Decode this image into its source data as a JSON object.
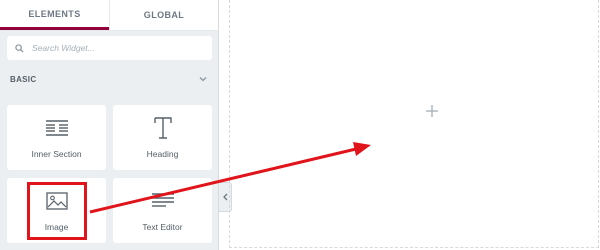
{
  "panel": {
    "tabs": [
      {
        "label": "ELEMENTS",
        "active": true
      },
      {
        "label": "GLOBAL",
        "active": false
      }
    ],
    "search": {
      "placeholder": "Search Widget...",
      "icon": "search-icon"
    },
    "section": {
      "title": "BASIC",
      "icon": "chevron-down-icon"
    },
    "widgets": [
      {
        "label": "Inner Section",
        "icon": "inner-section-icon"
      },
      {
        "label": "Heading",
        "icon": "heading-icon"
      },
      {
        "label": "Image",
        "icon": "image-icon",
        "highlighted": true
      },
      {
        "label": "Text Editor",
        "icon": "text-editor-icon"
      }
    ]
  },
  "canvas": {
    "add_icon": "plus-icon"
  },
  "annotation": {
    "color": "#e0141a",
    "type": "drag-arrow"
  },
  "colors": {
    "panel_bg": "#eceff1",
    "accent": "#93003c",
    "text": "#556068"
  }
}
